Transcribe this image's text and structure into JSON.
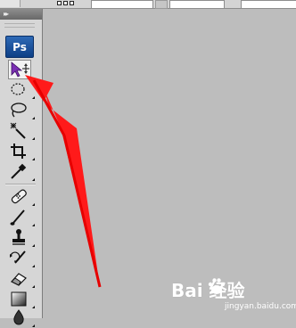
{
  "app": {
    "logo_text": "Ps"
  },
  "toolbox": {
    "collapse_glyph": "▸▸",
    "tools": [
      {
        "id": "move",
        "icon": "move-tool-icon",
        "active": true
      },
      {
        "id": "marquee",
        "icon": "elliptical-marquee-icon",
        "active": false
      },
      {
        "id": "lasso",
        "icon": "lasso-icon",
        "active": false
      },
      {
        "id": "magic-wand",
        "icon": "magic-wand-icon",
        "active": false
      },
      {
        "id": "crop",
        "icon": "crop-icon",
        "active": false
      },
      {
        "id": "eyedropper",
        "icon": "eyedropper-icon",
        "active": false
      },
      {
        "id": "healing",
        "icon": "healing-brush-icon",
        "active": false
      },
      {
        "id": "brush",
        "icon": "brush-icon",
        "active": false
      },
      {
        "id": "clone-stamp",
        "icon": "clone-stamp-icon",
        "active": false
      },
      {
        "id": "history-brush",
        "icon": "history-brush-icon",
        "active": false
      },
      {
        "id": "eraser",
        "icon": "eraser-icon",
        "active": false
      },
      {
        "id": "gradient",
        "icon": "gradient-icon",
        "active": false
      },
      {
        "id": "blur",
        "icon": "blur-icon",
        "active": false
      }
    ]
  },
  "watermark": {
    "brand": "Bai  经验",
    "url": "jingyan.baidu.com"
  },
  "colors": {
    "annotation_arrow": "#ff1a1a",
    "workspace_bg": "#bdbdbd",
    "logo_bg": "#1f56a3"
  }
}
